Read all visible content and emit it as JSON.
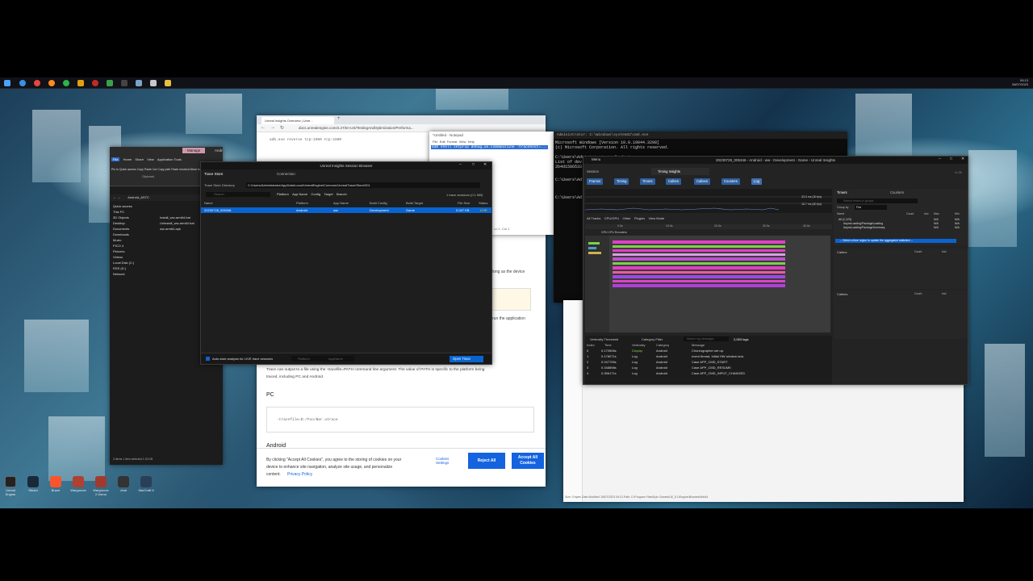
{
  "taskbar": {
    "clock_time": "09:13",
    "clock_date": "28/07/2023",
    "icons": [
      "start-icon",
      "edge-icon",
      "chrome-icon",
      "firefox-icon",
      "explorer-icon",
      "terminal-icon",
      "settings-icon",
      "tools-icon",
      "folder-icon"
    ]
  },
  "desktop_icons": [
    {
      "label": "Unreal Engine"
    },
    {
      "label": "Steam"
    },
    {
      "label": "Brave"
    },
    {
      "label": "Wargroove"
    },
    {
      "label": "Wargroove 2 Demo"
    },
    {
      "label": "chat"
    },
    {
      "label": "StarCraft II"
    }
  ],
  "explorer": {
    "tabs": [
      "Manage",
      "Android_ASTC"
    ],
    "ribbon_tabs": [
      "File",
      "Home",
      "Share",
      "View",
      "Application Tools"
    ],
    "ribbon_buttons": [
      "Pin to Quick access",
      "Copy",
      "Paste",
      "Cut",
      "Copy path",
      "Paste shortcut",
      "Move to"
    ],
    "clipboard_label": "Clipboard",
    "path": "Android_ASTC",
    "nav": [
      "Quick access",
      "This PC",
      "3D Objects",
      "Desktop",
      "Documents",
      "Downloads",
      "Music",
      "PICO 4",
      "Pictures",
      "Videos",
      "Local Disk (C:)",
      "RSS (D:)",
      "Network"
    ],
    "files": [
      "Install_ww-arm64.bat",
      "Uninstall_ww-arm64.bat",
      "ww-arm64.apk"
    ],
    "status": "3 items   1 item selected  1.30 KB"
  },
  "browser": {
    "tab_title": "Unreal Insights Overview | Unre...",
    "url": "docs.unrealengine.com/4.27/en-US/TestingAndOptimization/Performa...",
    "code_top": "adb.exe reverse tcp:1980 tcp:1980",
    "partial_1": "long as the device",
    "partial_2": "run the application",
    "paragraph_1": "Trace can output to a file using the -tracefile=PATH command line argument. The value of PATH is specific to the platform being",
    "paragraph_2": "traced, including PC and Android.",
    "heading_pc": "PC",
    "code_pc": "-tracefile=D:/Foo/Bar.utrace",
    "heading_android": "Android",
    "cookie_text_1": "By clicking \"Accept All Cookies\", you agree to the storing of cookies on your",
    "cookie_text_2": "device to enhance site navigation, analyze site usage, and personalize",
    "cookie_text_3": "content.",
    "privacy_link": "Privacy Policy",
    "cookies_settings": "Cookies Settings",
    "reject_all": "Reject All",
    "accept_all": "Accept All Cookies"
  },
  "notepad": {
    "title": "*Untitled - Notepad",
    "menu": [
      "File",
      "Edit",
      "Format",
      "View",
      "Help"
    ],
    "line": "adb shell setprop debug.ue.commandline -tracehost=...",
    "status": "Ln 1, Col 1"
  },
  "session": {
    "title": "Unreal Insights Session Browser",
    "tabs": [
      "Trace Store",
      "Connection"
    ],
    "directory_label": "Trace Store Directory",
    "directory": "C:/Users/Administrator/AppData/Local/UnrealEngine/Common/UnrealTrace/Store/001",
    "search_placeholder": "Search",
    "filters": [
      "Platform",
      "App Name",
      "Config",
      "Target",
      "Branch"
    ],
    "sessions_count": "1 trace sessions (0.1 MB)",
    "columns": [
      "Name",
      "Platform",
      "App Name",
      "Build Config",
      "Build Target",
      "File Size",
      "Status"
    ],
    "rows": [
      {
        "name": "20230728_005346",
        "platform": "Android",
        "app": "ww",
        "config": "Development",
        "target": "Game",
        "size": "0.047 KB",
        "status": "LIVE"
      }
    ],
    "auto_start": "Auto-start analysis for LIVE trace sessions",
    "platform_filter": "Platform",
    "app_filter": "AppName",
    "open_trace": "Open Trace"
  },
  "cmd": {
    "title": "Administrator: C:\\Windows\\system32\\cmd.exe",
    "lines": [
      "Microsoft Windows [Version 10.0.19044.3208]",
      "(c) Microsoft Corporation. All rights reserved.",
      "",
      "C:\\Users\\Administrator>adb devices",
      "List of dev",
      "2b4d1586533",
      "",
      "C:\\Users\\Ad",
      "",
      "C:\\Users\\Ad"
    ]
  },
  "insights": {
    "title": "20230728_005346 - Android - ww - Development - Game - Unreal Insights",
    "menu": "Menu",
    "session_tab": "Session",
    "insights_tab": "Timing Insights",
    "version": "v1.05",
    "toolbar": [
      "Frames",
      "Timing",
      "Timers",
      "Callers",
      "Callees",
      "Counters",
      "Log"
    ],
    "frame_readout_1": "33.3 ms (30 fps)",
    "frame_readout_2": "16.7 ms (60 fps)",
    "track_menu": [
      "All Tracks",
      "CPU/GPU",
      "Other",
      "Plugins",
      "View Mode"
    ],
    "ruler": [
      "0.0s",
      "10.0s",
      "20.0s",
      "30.0s",
      "40.0s"
    ],
    "track_label": "GPU  CPU  Encoders",
    "timers_tab": "Timers",
    "counters_tab": "Counters",
    "timers_search": "Search timers or groups",
    "group_by_label": "Group by",
    "group_by_value": "Flat",
    "timers_columns": [
      "Name",
      "Count",
      "Incl",
      "Max",
      "Min"
    ],
    "timer_rows": [
      {
        "name": "All (1,123)",
        "count": "",
        "incl": "",
        "max": "N/A",
        "min": "N/A"
      },
      {
        "name": "AsyncLoading/PackageLoading",
        "count": "",
        "incl": "",
        "max": "N/A",
        "min": "N/A"
      },
      {
        "name": "AsyncLoading/PackageSummary",
        "count": "",
        "incl": "",
        "max": "N/A",
        "min": "N/A"
      }
    ],
    "select_hint": "-- Select a time region to update the aggregated statistics! --",
    "callers_label": "Callers",
    "callees_label": "Callees",
    "panel_columns": [
      "Count",
      "Incl"
    ],
    "verbosity": "Verbosity Threshold",
    "category_filter": "Category Filter",
    "log_search": "Search log messages",
    "log_count": "2,053 logs",
    "log_columns": [
      "Index",
      "Time",
      "Verbosity",
      "Category",
      "Message"
    ],
    "log_rows": [
      {
        "index": "0",
        "time": "0.170506s",
        "verbosity": "Display",
        "category": "Android",
        "message": "Choreographer set up."
      },
      {
        "index": "1",
        "time": "0.178071s",
        "verbosity": "Log",
        "category": "Android",
        "message": "event thread, Initial HW window lock."
      },
      {
        "index": "2",
        "time": "0.247705s",
        "verbosity": "Log",
        "category": "Android",
        "message": "Case APP_CMD_START"
      },
      {
        "index": "3",
        "time": "0.348898s",
        "verbosity": "Log",
        "category": "Android",
        "message": "Case APP_CMD_RESUME"
      },
      {
        "index": "4",
        "time": "0.356171s",
        "verbosity": "Log",
        "category": "Android",
        "message": "Case APP_CMD_INPUT_CHANGED"
      }
    ]
  },
  "doc2": {
    "status": "Size: 0 bytes  Date Modified: 28/07/2023 09:13  Path: C:\\Program Files\\Epic Games\\UE_5.1\\Engine\\Binaries\\Win64"
  },
  "colors": {
    "accent_blue": "#1463e0",
    "selection_blue": "#0a64d0",
    "live_status": "#ffcc00",
    "timeline_pink": "#e040c8",
    "timeline_green": "#7cd04a"
  }
}
